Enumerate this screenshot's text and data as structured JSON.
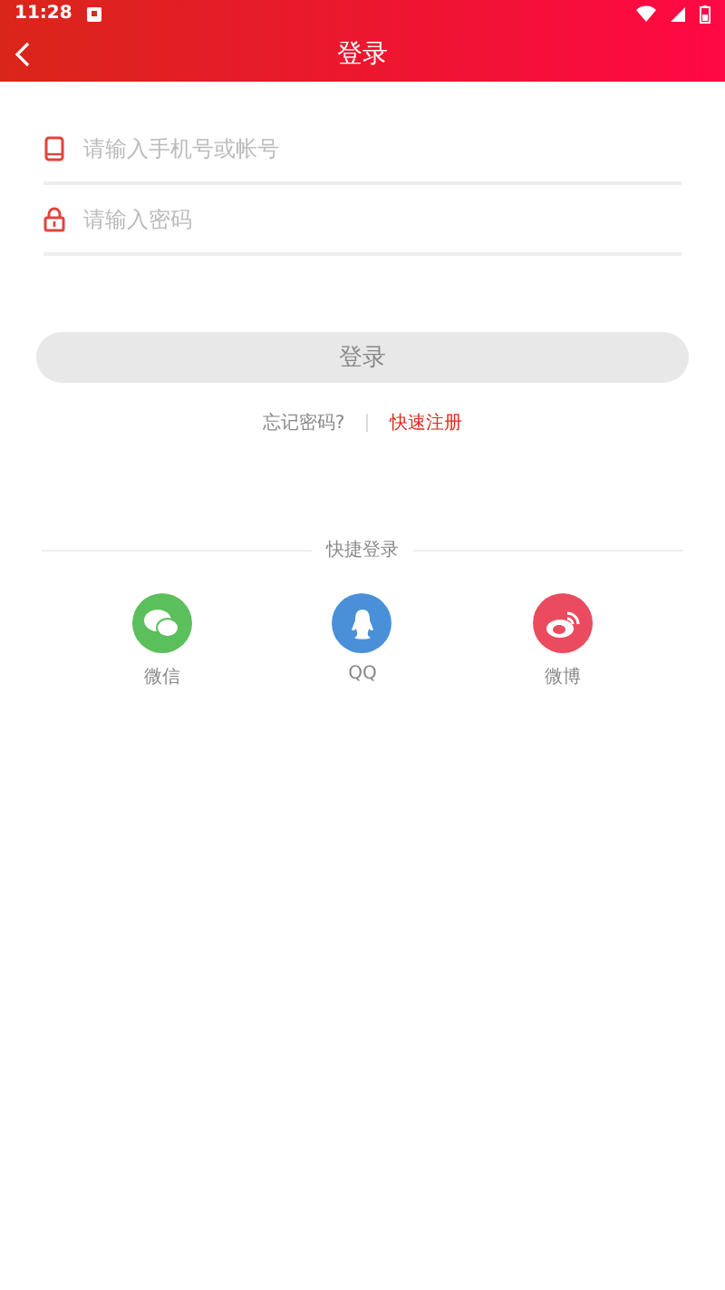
{
  "status_bar": {
    "time": "11:28"
  },
  "header": {
    "title": "登录"
  },
  "fields": [
    {
      "kind": "phone",
      "placeholder": "请输入手机号或帐号"
    },
    {
      "kind": "password",
      "placeholder": "请输入密码"
    }
  ],
  "login_button": {
    "label": "登录",
    "disabled": true
  },
  "links": {
    "forgot": "忘记密码?",
    "register": "快速注册"
  },
  "quick_login": {
    "title": "快捷登录",
    "items": [
      {
        "kind": "wechat",
        "label": "微信",
        "color": "#5bbf5b"
      },
      {
        "kind": "qq",
        "label": "QQ",
        "color": "#4a90d9"
      },
      {
        "kind": "weibo",
        "label": "微博",
        "color": "#ea4b5f"
      }
    ]
  }
}
